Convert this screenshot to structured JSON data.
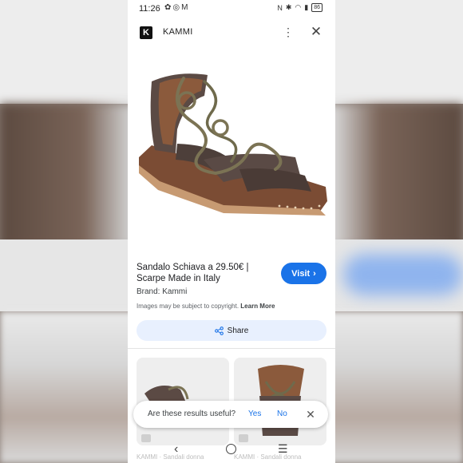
{
  "status_bar": {
    "time": "11:26",
    "battery": "86"
  },
  "header": {
    "site_name": "KAMMI",
    "logo_letter": "K",
    "more_icon": "more-vert-icon",
    "close_icon": "close-icon"
  },
  "product": {
    "title": "Sandalo Schiava a 29.50€ | Scarpe Made in Italy",
    "brand": "Brand: Kammi",
    "visit_label": "Visit",
    "copyright_text": "Images may be subject to copyright.",
    "learn_more_label": "Learn More",
    "share_label": "Share"
  },
  "related": [
    {
      "source": "KAMMI · Sandali donna"
    },
    {
      "source": "KAMMI · Sandali donna"
    }
  ],
  "feedback": {
    "question": "Are these results useful?",
    "yes_label": "Yes",
    "no_label": "No"
  },
  "colors": {
    "accent": "#1a73e8",
    "share_bg": "#e8f0fe"
  }
}
